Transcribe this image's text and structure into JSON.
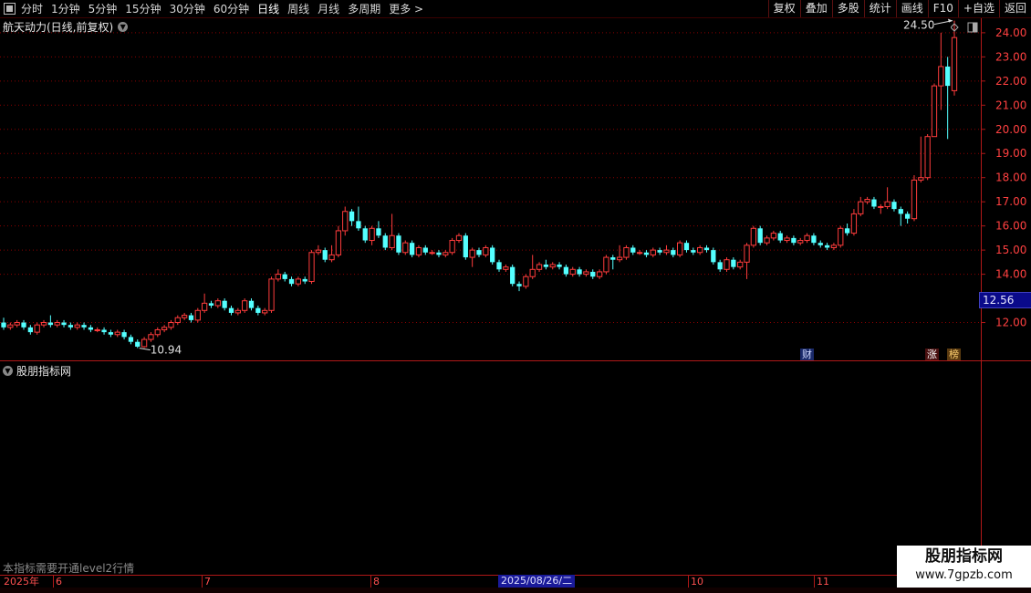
{
  "toolbar": {
    "periods": [
      "分时",
      "1分钟",
      "5分钟",
      "15分钟",
      "30分钟",
      "60分钟",
      "日线",
      "周线",
      "月线",
      "多周期",
      "更多 >"
    ],
    "active_period": "日线",
    "buttons": [
      "复权",
      "叠加",
      "多股",
      "统计",
      "画线",
      "F10",
      "+自选",
      "返回"
    ]
  },
  "main_panel": {
    "title": "航天动力(日线,前复权)",
    "current_price_tag": "12.56",
    "badges": {
      "cai": "财",
      "zhang": "涨",
      "bang": "榜"
    }
  },
  "sub_panel": {
    "title": "股朋指标网",
    "note": "本指标需要开通level2行情"
  },
  "date_axis": {
    "labels": [
      "2025年",
      "6",
      "7",
      "8",
      "10",
      "11"
    ],
    "highlight": "2025/08/26/二"
  },
  "watermark": {
    "title": "股朋指标网",
    "url": "www.7gpzb.com"
  },
  "colors": {
    "up": "#ff3c3c",
    "down": "#54ffff",
    "grid": "#8a0000",
    "axis": "#b01818",
    "price_label": "#ff4040"
  },
  "chart_data": {
    "type": "candlestick",
    "price_axis_ticks": [
      "24.00",
      "23.00",
      "22.00",
      "21.00",
      "20.00",
      "19.00",
      "18.00",
      "17.00",
      "16.00",
      "15.00",
      "14.00",
      "12.00"
    ],
    "ylim": [
      11.0,
      24.6
    ],
    "annotations": {
      "high": "24.50",
      "low": "10.94"
    },
    "candles": [
      [
        12.0,
        11.8,
        12.2,
        11.7
      ],
      [
        11.8,
        11.9,
        12.0,
        11.7
      ],
      [
        11.9,
        12.0,
        12.1,
        11.8
      ],
      [
        12.0,
        11.8,
        12.1,
        11.7
      ],
      [
        11.8,
        11.6,
        11.9,
        11.5
      ],
      [
        11.6,
        11.9,
        12.0,
        11.5
      ],
      [
        11.9,
        12.0,
        12.1,
        11.8
      ],
      [
        12.0,
        11.9,
        12.3,
        11.8
      ],
      [
        11.9,
        12.0,
        12.1,
        11.8
      ],
      [
        12.0,
        11.9,
        12.1,
        11.8
      ],
      [
        11.9,
        11.8,
        12.0,
        11.7
      ],
      [
        11.8,
        11.9,
        12.0,
        11.7
      ],
      [
        11.9,
        11.8,
        12.0,
        11.7
      ],
      [
        11.8,
        11.7,
        11.9,
        11.6
      ],
      [
        11.7,
        11.7,
        11.8,
        11.6
      ],
      [
        11.7,
        11.6,
        11.8,
        11.5
      ],
      [
        11.6,
        11.5,
        11.7,
        11.4
      ],
      [
        11.5,
        11.6,
        11.7,
        11.4
      ],
      [
        11.6,
        11.4,
        11.7,
        11.3
      ],
      [
        11.4,
        11.2,
        11.5,
        11.1
      ],
      [
        11.2,
        11.0,
        11.3,
        10.94
      ],
      [
        11.0,
        11.3,
        11.4,
        10.95
      ],
      [
        11.3,
        11.5,
        11.6,
        11.2
      ],
      [
        11.5,
        11.7,
        11.8,
        11.4
      ],
      [
        11.7,
        11.8,
        11.9,
        11.6
      ],
      [
        11.8,
        12.0,
        12.1,
        11.7
      ],
      [
        12.0,
        12.2,
        12.3,
        11.9
      ],
      [
        12.2,
        12.3,
        12.4,
        12.1
      ],
      [
        12.3,
        12.1,
        12.4,
        12.0
      ],
      [
        12.1,
        12.5,
        12.6,
        12.0
      ],
      [
        12.5,
        12.8,
        13.2,
        12.4
      ],
      [
        12.8,
        12.7,
        12.9,
        12.6
      ],
      [
        12.7,
        12.9,
        13.0,
        12.6
      ],
      [
        12.9,
        12.6,
        13.0,
        12.5
      ],
      [
        12.6,
        12.4,
        12.7,
        12.3
      ],
      [
        12.4,
        12.5,
        12.6,
        12.3
      ],
      [
        12.5,
        12.9,
        13.0,
        12.4
      ],
      [
        12.9,
        12.6,
        13.0,
        12.5
      ],
      [
        12.6,
        12.4,
        12.7,
        12.3
      ],
      [
        12.4,
        12.5,
        12.6,
        12.3
      ],
      [
        12.5,
        13.8,
        13.9,
        12.4
      ],
      [
        13.8,
        14.0,
        14.2,
        13.7
      ],
      [
        14.0,
        13.8,
        14.1,
        13.7
      ],
      [
        13.8,
        13.6,
        13.9,
        13.5
      ],
      [
        13.6,
        13.8,
        13.9,
        13.5
      ],
      [
        13.8,
        13.7,
        13.9,
        13.6
      ],
      [
        13.7,
        14.9,
        15.0,
        13.6
      ],
      [
        14.9,
        15.0,
        15.2,
        14.8
      ],
      [
        15.0,
        14.6,
        15.1,
        14.5
      ],
      [
        14.6,
        14.8,
        15.2,
        14.5
      ],
      [
        14.8,
        15.8,
        16.0,
        14.7
      ],
      [
        15.8,
        16.6,
        16.8,
        15.6
      ],
      [
        16.6,
        16.2,
        16.7,
        16.0
      ],
      [
        16.2,
        15.9,
        16.8,
        15.8
      ],
      [
        15.9,
        15.4,
        16.0,
        15.3
      ],
      [
        15.4,
        15.9,
        16.0,
        15.2
      ],
      [
        15.9,
        15.6,
        16.2,
        15.5
      ],
      [
        15.6,
        15.1,
        15.7,
        15.0
      ],
      [
        15.1,
        15.6,
        16.5,
        15.0
      ],
      [
        15.6,
        14.9,
        15.7,
        14.8
      ],
      [
        14.9,
        15.3,
        15.4,
        14.8
      ],
      [
        15.3,
        14.8,
        15.4,
        14.7
      ],
      [
        14.8,
        15.1,
        15.2,
        14.7
      ],
      [
        15.1,
        14.9,
        15.2,
        14.8
      ],
      [
        14.9,
        14.9,
        15.0,
        14.8
      ],
      [
        14.9,
        14.8,
        15.0,
        14.7
      ],
      [
        14.8,
        14.9,
        15.0,
        14.7
      ],
      [
        14.9,
        15.4,
        15.5,
        14.8
      ],
      [
        15.4,
        15.6,
        15.7,
        15.3
      ],
      [
        15.6,
        14.7,
        15.7,
        14.6
      ],
      [
        14.7,
        15.0,
        15.1,
        14.3
      ],
      [
        15.0,
        14.8,
        15.1,
        14.7
      ],
      [
        14.8,
        15.1,
        15.2,
        14.7
      ],
      [
        15.1,
        14.5,
        15.2,
        14.4
      ],
      [
        14.5,
        14.2,
        14.6,
        14.1
      ],
      [
        14.2,
        14.3,
        14.4,
        14.1
      ],
      [
        14.3,
        13.6,
        14.4,
        13.5
      ],
      [
        13.6,
        13.5,
        13.7,
        13.3
      ],
      [
        13.5,
        13.9,
        14.0,
        13.4
      ],
      [
        13.9,
        14.2,
        14.8,
        13.8
      ],
      [
        14.2,
        14.4,
        14.5,
        14.1
      ],
      [
        14.4,
        14.3,
        14.6,
        14.2
      ],
      [
        14.3,
        14.4,
        14.5,
        14.2
      ],
      [
        14.4,
        14.3,
        14.5,
        14.2
      ],
      [
        14.3,
        14.0,
        14.4,
        13.9
      ],
      [
        14.0,
        14.2,
        14.3,
        13.9
      ],
      [
        14.2,
        14.0,
        14.3,
        13.9
      ],
      [
        14.0,
        14.1,
        14.2,
        13.9
      ],
      [
        14.1,
        13.9,
        14.2,
        13.8
      ],
      [
        13.9,
        14.1,
        14.2,
        13.8
      ],
      [
        14.1,
        14.7,
        14.8,
        14.0
      ],
      [
        14.7,
        14.6,
        14.8,
        14.2
      ],
      [
        14.6,
        14.7,
        15.2,
        14.5
      ],
      [
        14.7,
        15.1,
        15.2,
        14.6
      ],
      [
        15.1,
        14.9,
        15.2,
        14.8
      ],
      [
        14.9,
        14.9,
        15.0,
        14.8
      ],
      [
        14.9,
        14.8,
        15.0,
        14.7
      ],
      [
        14.8,
        15.0,
        15.1,
        14.7
      ],
      [
        15.0,
        14.9,
        15.1,
        14.8
      ],
      [
        14.9,
        15.0,
        15.2,
        14.8
      ],
      [
        15.0,
        14.8,
        15.1,
        14.7
      ],
      [
        14.8,
        15.3,
        15.4,
        14.7
      ],
      [
        15.3,
        15.0,
        15.4,
        14.9
      ],
      [
        15.0,
        14.9,
        15.1,
        14.8
      ],
      [
        14.9,
        15.1,
        15.2,
        14.8
      ],
      [
        15.1,
        15.0,
        15.2,
        14.9
      ],
      [
        15.0,
        14.5,
        15.1,
        14.4
      ],
      [
        14.5,
        14.2,
        14.6,
        14.1
      ],
      [
        14.2,
        14.6,
        14.7,
        14.1
      ],
      [
        14.6,
        14.3,
        14.7,
        14.2
      ],
      [
        14.3,
        14.5,
        14.6,
        14.2
      ],
      [
        14.5,
        15.2,
        15.3,
        13.8
      ],
      [
        15.2,
        15.9,
        16.0,
        15.1
      ],
      [
        15.9,
        15.3,
        16.0,
        15.2
      ],
      [
        15.3,
        15.5,
        15.6,
        15.2
      ],
      [
        15.5,
        15.7,
        15.8,
        15.4
      ],
      [
        15.7,
        15.4,
        15.8,
        15.3
      ],
      [
        15.4,
        15.5,
        15.6,
        15.3
      ],
      [
        15.5,
        15.3,
        15.6,
        15.2
      ],
      [
        15.3,
        15.4,
        15.5,
        15.2
      ],
      [
        15.4,
        15.6,
        15.7,
        15.3
      ],
      [
        15.6,
        15.3,
        15.7,
        15.2
      ],
      [
        15.3,
        15.2,
        15.4,
        15.1
      ],
      [
        15.2,
        15.1,
        15.3,
        15.0
      ],
      [
        15.1,
        15.2,
        15.3,
        15.0
      ],
      [
        15.2,
        15.9,
        16.0,
        15.1
      ],
      [
        15.9,
        15.7,
        16.1,
        15.6
      ],
      [
        15.7,
        16.5,
        16.7,
        15.6
      ],
      [
        16.5,
        17.0,
        17.2,
        16.4
      ],
      [
        17.0,
        17.1,
        17.2,
        16.9
      ],
      [
        17.1,
        16.8,
        17.2,
        16.7
      ],
      [
        16.8,
        16.8,
        16.9,
        16.5
      ],
      [
        16.8,
        17.0,
        17.6,
        16.7
      ],
      [
        17.0,
        16.7,
        17.1,
        16.6
      ],
      [
        16.7,
        16.5,
        16.8,
        16.0
      ],
      [
        16.5,
        16.3,
        16.6,
        16.1
      ],
      [
        16.3,
        17.9,
        18.1,
        16.2
      ],
      [
        17.9,
        18.0,
        19.7,
        17.8
      ],
      [
        18.0,
        19.7,
        19.8,
        17.9
      ],
      [
        19.7,
        21.8,
        21.9,
        20.6
      ],
      [
        21.8,
        22.6,
        24.0,
        20.8
      ],
      [
        22.6,
        21.8,
        23.0,
        19.6
      ],
      [
        21.6,
        23.8,
        24.5,
        21.4
      ]
    ]
  }
}
